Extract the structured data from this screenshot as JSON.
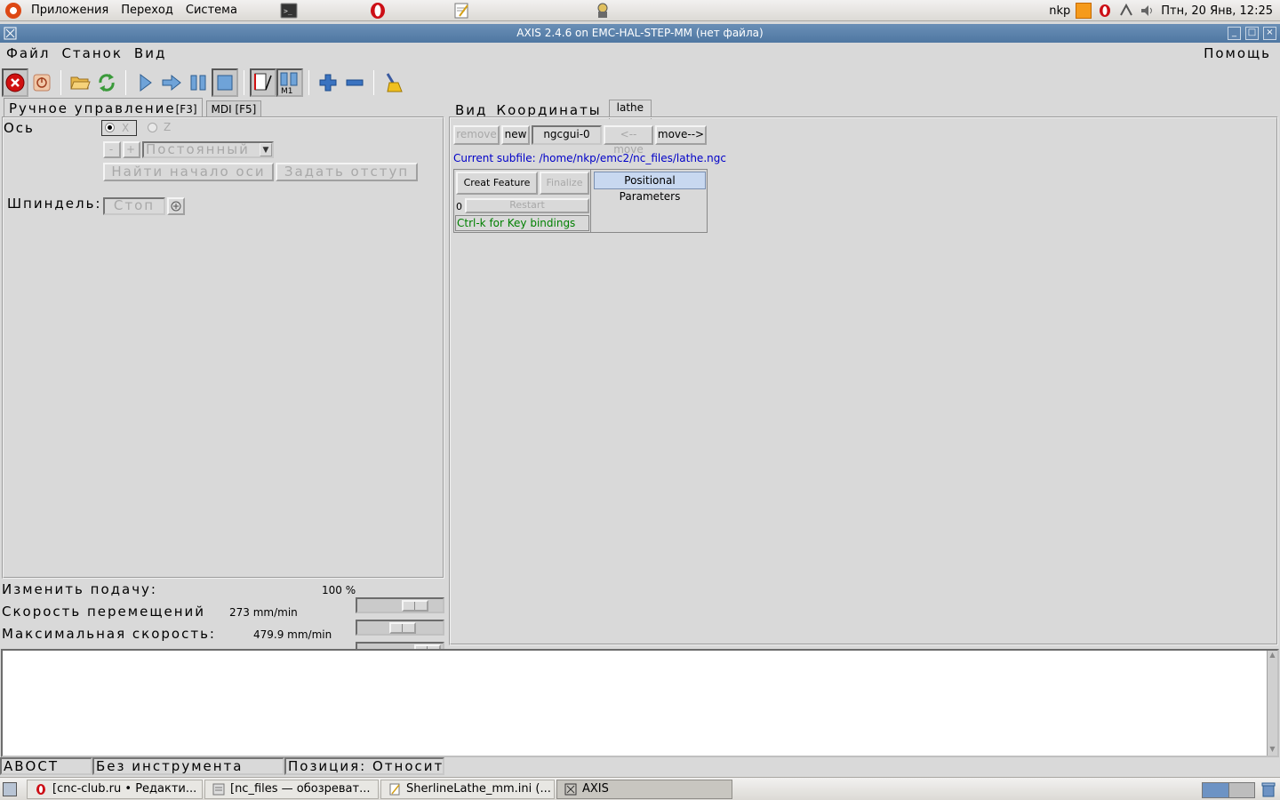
{
  "top_panel": {
    "menus": [
      "Приложения",
      "Переход",
      "Система"
    ],
    "user": "nkp",
    "clock": "Птн, 20 Янв, 12:25"
  },
  "window": {
    "title": "AXIS 2.4.6 on EMC-HAL-STEP-MM (нет файла)"
  },
  "menubar": {
    "file": "Файл",
    "machine": "Станок",
    "view": "Вид",
    "help": "Помощь"
  },
  "left_tabs": {
    "manual": "Ручное управление",
    "manual_key": "[F3]",
    "mdi": "MDI [F5]"
  },
  "manual": {
    "axis_label": "Ось",
    "axis_x": "X",
    "axis_z": "Z",
    "minus": "-",
    "plus": "+",
    "jog_mode": "Постоянный",
    "home_button": "Найти начало оси",
    "touch_off_button": "Задать отступ",
    "spindle_label": "Шпиндель:",
    "spindle_stop": "Стоп"
  },
  "overrides": {
    "feed_label": "Изменить подачу:",
    "feed_value": "100 %",
    "feed_fraction": 0.78,
    "jog_label": "Скорость перемещений",
    "jog_value": "273 mm/min",
    "jog_fraction": 0.57,
    "max_label": "Максимальная скорость:",
    "max_value": "479.9 mm/min",
    "max_fraction": 1.0
  },
  "right_tabs": {
    "view": "Вид",
    "coords": "Координаты",
    "lathe": "lathe"
  },
  "ngcgui": {
    "remove": "remove",
    "new": "new",
    "page": "ngcgui-0",
    "move_left": "<--move",
    "move_right": "move-->",
    "subfile": "Current subfile: /home/nkp/emc2/nc_files/lathe.ngc",
    "create_feature": "Creat Feature",
    "finalize": "Finalize",
    "count": "0",
    "restart": "Restart",
    "keybindings": "Ctrl-k for Key bindings",
    "positional": "Positional Parameters"
  },
  "statusbar": {
    "estop": "АВОСТ",
    "tool": "Без инструмента",
    "position": "Позиция: Относите"
  },
  "taskbar": {
    "tasks": [
      "[cnc-club.ru • Редакти...",
      "[nc_files — обозреват...",
      "SherlineLathe_mm.ini (...",
      "AXIS"
    ]
  },
  "colors": {
    "link": "#0000c8",
    "hint": "#008000",
    "title_bar": "#557ba6",
    "estop_red": "#d01010"
  }
}
